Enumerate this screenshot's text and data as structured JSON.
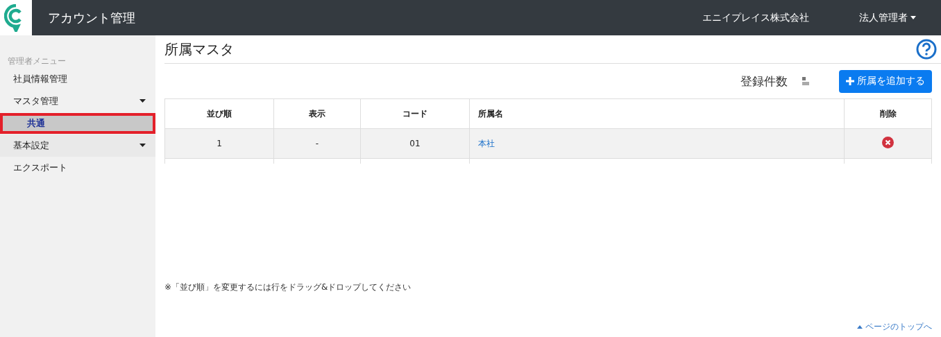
{
  "header": {
    "title": "アカウント管理",
    "company": "エニイプレイス株式会社",
    "user_menu": "法人管理者"
  },
  "sidebar": {
    "heading": "管理者メニュー",
    "items": [
      {
        "label": "社員情報管理",
        "kind": "link",
        "selected": false
      },
      {
        "label": "マスタ管理",
        "kind": "group",
        "selected": false,
        "children": [
          {
            "label": "共通",
            "selected": true,
            "highlighted": true
          }
        ]
      },
      {
        "label": "基本設定",
        "kind": "group",
        "selected": false
      },
      {
        "label": "エクスポート",
        "kind": "link",
        "selected": false
      }
    ]
  },
  "page": {
    "title": "所属マスタ",
    "count_label": "登録件数",
    "add_button": "所属を追加する"
  },
  "table": {
    "columns": [
      "並び順",
      "表示",
      "コード",
      "所属名",
      "削除"
    ],
    "rows": [
      {
        "order": "1",
        "display": "-",
        "code": "01",
        "name": "本社"
      }
    ]
  },
  "note": "※「並び順」を変更するには行をドラッグ&ドロップしてください",
  "page_top_link": "ページのトップへ"
}
